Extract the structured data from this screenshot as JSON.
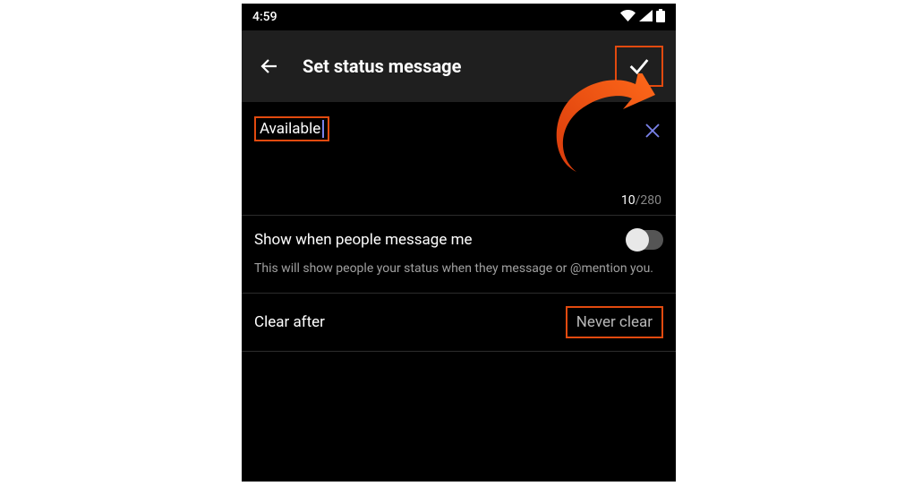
{
  "statusbar": {
    "time": "4:59"
  },
  "appbar": {
    "title": "Set status message"
  },
  "status": {
    "value": "Available ",
    "counter_current": "10",
    "counter_sep": "/",
    "counter_max": "280"
  },
  "showWhen": {
    "label": "Show when people message me",
    "description": "This will show people your status when they message or @mention you."
  },
  "clearAfter": {
    "label": "Clear after",
    "value": "Never clear"
  }
}
